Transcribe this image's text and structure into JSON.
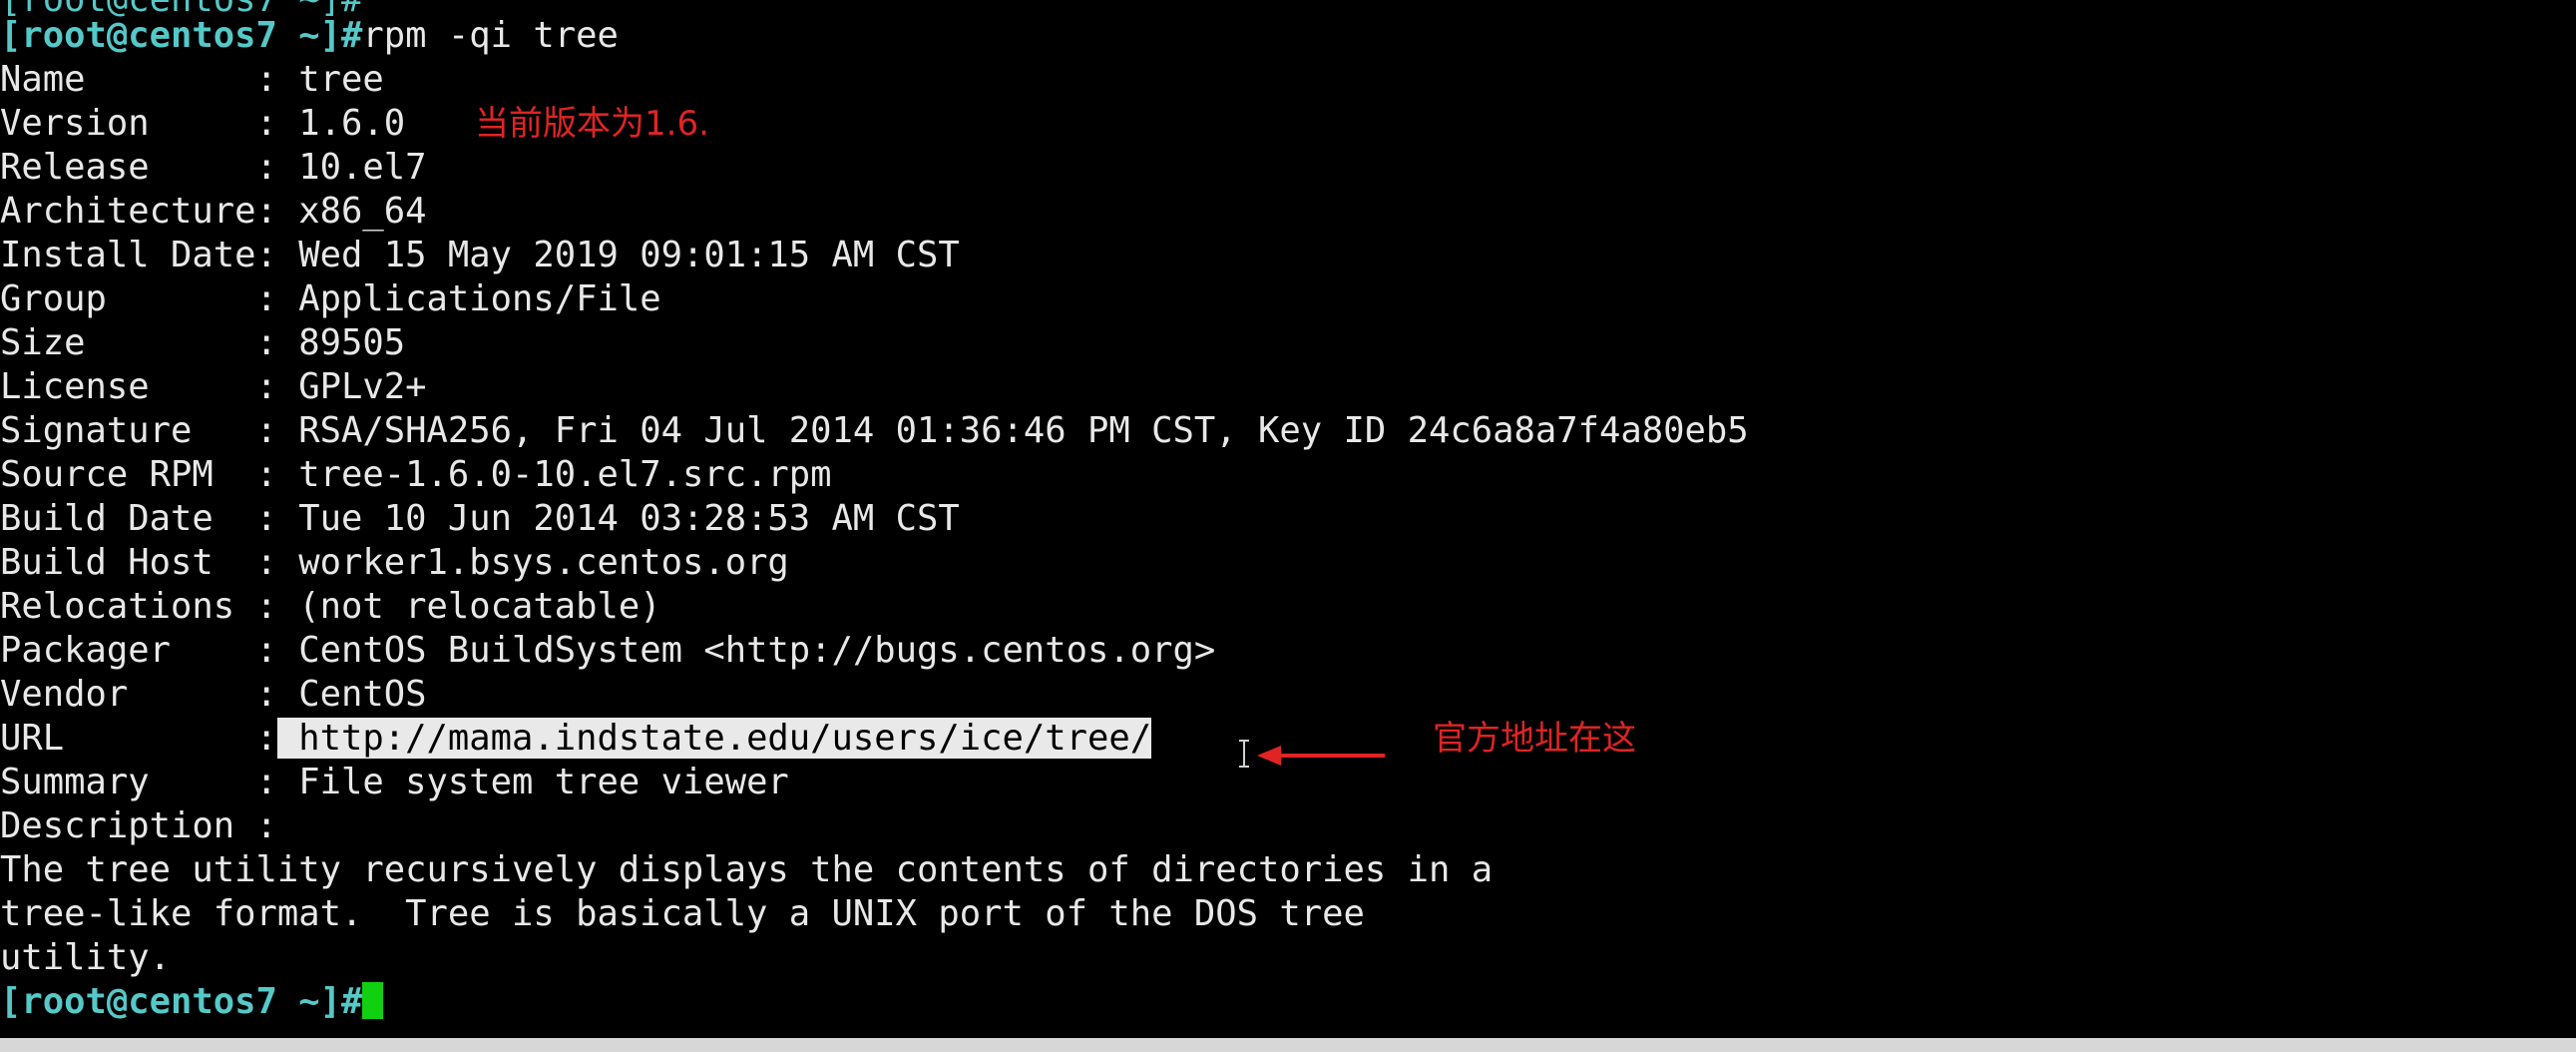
{
  "terminal": {
    "top_partial": "[root@centos7 ~]#",
    "prompt": "[root@centos7 ~]#",
    "command": "rpm -qi tree",
    "fields": [
      {
        "label": "Name        ",
        "value": "tree"
      },
      {
        "label": "Version     ",
        "value": "1.6.0"
      },
      {
        "label": "Release     ",
        "value": "10.el7"
      },
      {
        "label": "Architecture",
        "value": "x86_64"
      },
      {
        "label": "Install Date",
        "value": "Wed 15 May 2019 09:01:15 AM CST"
      },
      {
        "label": "Group       ",
        "value": "Applications/File"
      },
      {
        "label": "Size        ",
        "value": "89505"
      },
      {
        "label": "License     ",
        "value": "GPLv2+"
      },
      {
        "label": "Signature   ",
        "value": "RSA/SHA256, Fri 04 Jul 2014 01:36:46 PM CST, Key ID 24c6a8a7f4a80eb5"
      },
      {
        "label": "Source RPM  ",
        "value": "tree-1.6.0-10.el7.src.rpm"
      },
      {
        "label": "Build Date  ",
        "value": "Tue 10 Jun 2014 03:28:53 AM CST"
      },
      {
        "label": "Build Host  ",
        "value": "worker1.bsys.centos.org"
      },
      {
        "label": "Relocations ",
        "value": "(not relocatable)"
      },
      {
        "label": "Packager    ",
        "value": "CentOS BuildSystem <http://bugs.centos.org>"
      },
      {
        "label": "Vendor      ",
        "value": "CentOS"
      },
      {
        "label": "URL         ",
        "value": "http://mama.indstate.edu/users/ice/tree/"
      },
      {
        "label": "Summary     ",
        "value": "File system tree viewer"
      },
      {
        "label": "Description ",
        "value": ""
      }
    ],
    "description_lines": [
      "The tree utility recursively displays the contents of directories in a",
      "tree-like format.  Tree is basically a UNIX port of the DOS tree",
      "utility."
    ]
  },
  "annotations": {
    "version_note": "当前版本为1.6.",
    "url_note": "官方地址在这",
    "color": "#e02424"
  },
  "colors": {
    "background": "#000000",
    "prompt": "#55c8c8",
    "text": "#e8e8e8",
    "cursor": "#11d011",
    "selection": "#e9e9e9"
  }
}
